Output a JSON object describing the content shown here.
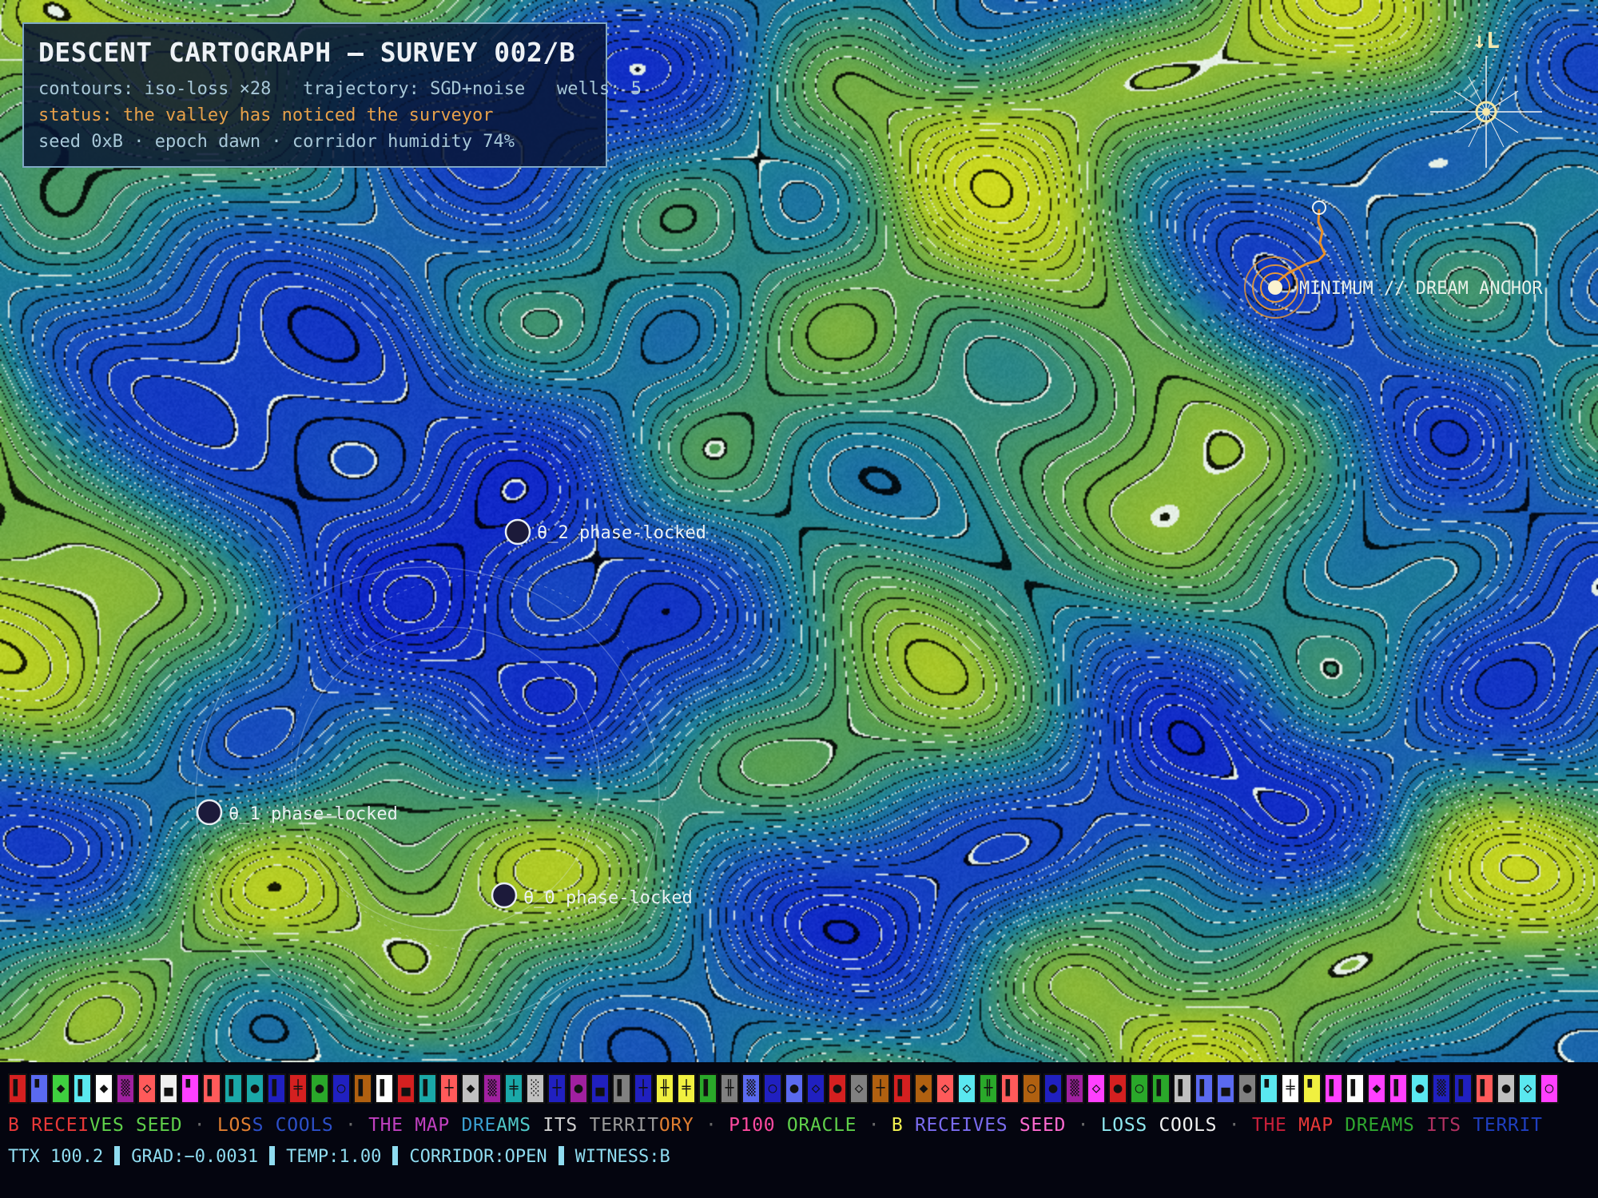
{
  "panel": {
    "title": "DESCENT CARTOGRAPH — SURVEY 002/B",
    "meta": "contours: iso-loss ×28   trajectory: SGD+noise   wells: 5",
    "status": "status: the valley has noticed the surveyor",
    "seed": "seed 0xB · epoch dawn · corridor humidity 74%"
  },
  "compass": {
    "label": "↓L"
  },
  "anchor": {
    "label": "MINIMUM // DREAM ANCHOR"
  },
  "markers": [
    {
      "label": "θ_2 phase-locked"
    },
    {
      "label": "θ_1 phase-locked"
    },
    {
      "label": "θ_0 phase-locked"
    }
  ],
  "ticker": [
    {
      "text": "B",
      "color": "#e83838"
    },
    {
      "text": " RECEI",
      "color": "#e83838"
    },
    {
      "text": "VES SEED",
      "color": "#5fd04a"
    },
    {
      "text": " · ",
      "color": "#6a6a6a"
    },
    {
      "text": "LOS",
      "color": "#e07e30"
    },
    {
      "text": "S COOLS",
      "color": "#2c4fc8"
    },
    {
      "text": " · ",
      "color": "#6a6a6a"
    },
    {
      "text": "THE MAP",
      "color": "#c040c0"
    },
    {
      "text": " DRE",
      "color": "#3a9fd0"
    },
    {
      "text": "AMS",
      "color": "#50c8c8"
    },
    {
      "text": " ITS ",
      "color": "#d0d0d0"
    },
    {
      "text": "TERRIT",
      "color": "#9a9a9a"
    },
    {
      "text": "ORY",
      "color": "#e07e30"
    },
    {
      "text": " · ",
      "color": "#6a6a6a"
    },
    {
      "text": "P100",
      "color": "#ff4aa0"
    },
    {
      "text": " ORACLE",
      "color": "#5fd04a"
    },
    {
      "text": " · ",
      "color": "#6a6a6a"
    },
    {
      "text": "B ",
      "color": "#f0f050"
    },
    {
      "text": "RECEIVES",
      "color": "#7b6cf0"
    },
    {
      "text": " SEED",
      "color": "#ff6ad0"
    },
    {
      "text": " · ",
      "color": "#6a6a6a"
    },
    {
      "text": "LOSS",
      "color": "#8fe8f0"
    },
    {
      "text": " COOLS",
      "color": "#f0f0f0"
    },
    {
      "text": " · ",
      "color": "#6a6a6a"
    },
    {
      "text": "THE ",
      "color": "#c81f3a"
    },
    {
      "text": "MAP ",
      "color": "#e83838"
    },
    {
      "text": "DREAMS",
      "color": "#2fa82f"
    },
    {
      "text": " ITS ",
      "color": "#b03060"
    },
    {
      "text": "TERRIT",
      "color": "#1f3fc0"
    }
  ],
  "status_bar": {
    "ttx": "TTX 100.2",
    "grad": "GRAD:−0.0031",
    "temp": "TEMP:1.00",
    "corridor": "CORRIDOR:OPEN",
    "witness": "WITNESS:B"
  },
  "glyphs": [
    {
      "bg": "#d42020",
      "fg": "▌"
    },
    {
      "bg": "#5a6af0",
      "fg": "▘"
    },
    {
      "bg": "#3fd03f",
      "fg": "◆"
    },
    {
      "bg": "#5ae8f0",
      "fg": "▌"
    },
    {
      "bg": "#ffffff",
      "fg": "◆"
    },
    {
      "bg": "#a020a0",
      "fg": "▒"
    },
    {
      "bg": "#ff5a5a",
      "fg": "◇"
    },
    {
      "bg": "#f0f0f0",
      "fg": "▄"
    },
    {
      "bg": "#ff40ff",
      "fg": "▘"
    },
    {
      "bg": "#ff5a5a",
      "fg": "▌"
    },
    {
      "bg": "#1aa8a8",
      "fg": "▌"
    },
    {
      "bg": "#1aa8a8",
      "fg": "●"
    },
    {
      "bg": "#2020c0",
      "fg": "▌"
    },
    {
      "bg": "#d42020",
      "fg": "╪"
    },
    {
      "bg": "#2aa82a",
      "fg": "●"
    },
    {
      "bg": "#2020c0",
      "fg": "○"
    },
    {
      "bg": "#b06010",
      "fg": "▌"
    },
    {
      "bg": "#ffffff",
      "fg": "▌"
    },
    {
      "bg": "#d42020",
      "fg": "▄"
    },
    {
      "bg": "#1aa8a8",
      "fg": "▌"
    },
    {
      "bg": "#ff5a5a",
      "fg": "┼"
    },
    {
      "bg": "#c0c0c0",
      "fg": "◆"
    },
    {
      "bg": "#a020a0",
      "fg": "▒"
    },
    {
      "bg": "#1aa8a8",
      "fg": "╪"
    },
    {
      "bg": "#c0c0c0",
      "fg": "░"
    },
    {
      "bg": "#2020c0",
      "fg": "┼"
    },
    {
      "bg": "#a020a0",
      "fg": "●"
    },
    {
      "bg": "#2020c0",
      "fg": "▄"
    },
    {
      "bg": "#808080",
      "fg": "▌"
    },
    {
      "bg": "#2020c0",
      "fg": "┼"
    },
    {
      "bg": "#f0f040",
      "fg": "╫"
    },
    {
      "bg": "#f0f040",
      "fg": "╪"
    },
    {
      "bg": "#2aa82a",
      "fg": "▌"
    },
    {
      "bg": "#808080",
      "fg": "╫"
    },
    {
      "bg": "#5a6af0",
      "fg": "▒"
    },
    {
      "bg": "#2020c0",
      "fg": "○"
    },
    {
      "bg": "#5a6af0",
      "fg": "●"
    },
    {
      "bg": "#2020c0",
      "fg": "◇"
    },
    {
      "bg": "#d42020",
      "fg": "●"
    },
    {
      "bg": "#808080",
      "fg": "◇"
    },
    {
      "bg": "#b06010",
      "fg": "┼"
    },
    {
      "bg": "#d42020",
      "fg": "▌"
    },
    {
      "bg": "#b06010",
      "fg": "◆"
    },
    {
      "bg": "#ff5a5a",
      "fg": "◇"
    },
    {
      "bg": "#5ae8f0",
      "fg": "◇"
    },
    {
      "bg": "#2aa82a",
      "fg": "╫"
    },
    {
      "bg": "#ff5a5a",
      "fg": "▌"
    },
    {
      "bg": "#b06010",
      "fg": "○"
    },
    {
      "bg": "#2020c0",
      "fg": "●"
    },
    {
      "bg": "#a020a0",
      "fg": "▒"
    },
    {
      "bg": "#ff40ff",
      "fg": "◇"
    },
    {
      "bg": "#d42020",
      "fg": "●"
    },
    {
      "bg": "#2aa82a",
      "fg": "○"
    },
    {
      "bg": "#2aa82a",
      "fg": "▌"
    },
    {
      "bg": "#c0c0c0",
      "fg": "▌"
    },
    {
      "bg": "#5a6af0",
      "fg": "▌"
    },
    {
      "bg": "#5a6af0",
      "fg": "▄"
    },
    {
      "bg": "#808080",
      "fg": "●"
    },
    {
      "bg": "#5ae8f0",
      "fg": "▘"
    },
    {
      "bg": "#ffffff",
      "fg": "╪"
    },
    {
      "bg": "#f0f040",
      "fg": "▘"
    },
    {
      "bg": "#ff40ff",
      "fg": "▌"
    },
    {
      "bg": "#ffffff",
      "fg": "▌"
    },
    {
      "bg": "#ff40ff",
      "fg": "◆"
    },
    {
      "bg": "#ff40ff",
      "fg": "▌"
    },
    {
      "bg": "#5ae8f0",
      "fg": "●"
    },
    {
      "bg": "#2020c0",
      "fg": "▒"
    },
    {
      "bg": "#2020c0",
      "fg": "▌"
    },
    {
      "bg": "#ff5a5a",
      "fg": "▌"
    },
    {
      "bg": "#c0c0c0",
      "fg": "●"
    },
    {
      "bg": "#5ae8f0",
      "fg": "◇"
    },
    {
      "bg": "#ff40ff",
      "fg": "○"
    }
  ],
  "colors": {
    "panel_title": "#eef2f6",
    "status_text": "#e6a04a",
    "status_bar_text": "#8fdcf0",
    "marker_fill": "#1c1a3a",
    "anchor_ring": "#e89a3a"
  }
}
